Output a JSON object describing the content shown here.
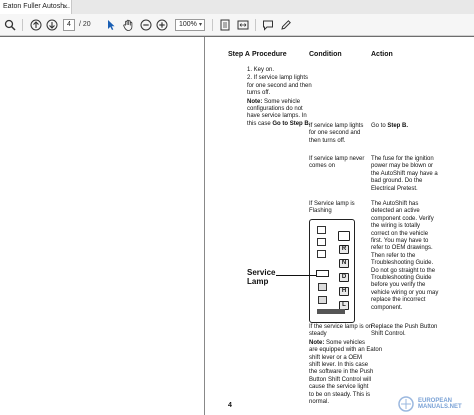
{
  "tab": {
    "title": "Eaton Fuller Autosh...",
    "close": "×"
  },
  "toolbar": {
    "page_current": "4",
    "page_total": "/ 20",
    "zoom": "100%",
    "zoom_arrow": "▾",
    "icons": [
      "search-icon",
      "page-up-icon",
      "page-down-icon",
      "select-cursor-icon",
      "hand-icon",
      "zoom-out-icon",
      "zoom-in-icon",
      "fit-page-icon",
      "fit-width-icon",
      "comment-icon",
      "edit-icon"
    ]
  },
  "table": {
    "headers": {
      "step": "Step A",
      "procedure": "Procedure",
      "condition": "Condition",
      "action": "Action"
    },
    "procedure_lines": [
      "1.  Key on.",
      "2.  If service lamp lights",
      "for one second and then",
      "turns off."
    ],
    "note_label": "Note:",
    "note_lines": [
      " Some vehicle",
      "configurations do not",
      "have service lamps. In",
      "this case"
    ],
    "note_goto": "Go to Step B.",
    "rows": [
      {
        "condition": [
          "If service lamp lights",
          "for one second and",
          "then turns off."
        ],
        "action_prefix": "Go to ",
        "action_bold": "Step B."
      },
      {
        "condition": [
          "If service lamp never",
          "comes on"
        ],
        "action": [
          "The fuse for the ignition",
          "power may be blown or",
          "the AutoShift may have a",
          "bad ground. Do the",
          "Electrical Pretest."
        ]
      },
      {
        "condition": [
          "If Service lamp is",
          "Flashing"
        ],
        "action": [
          "The AutoShift has",
          "detected an active",
          "component code. Verify",
          "the wiring is totally",
          "correct on the vehicle",
          "first. You may have to",
          "refer to OEM drawings.",
          "Then refer to the",
          "Troubleshooting Guide.",
          "Do not go straight to the",
          "Troubleshooting Guide",
          "before you verify the",
          "vehicle wiring or you may",
          "replace the incorrect",
          "component."
        ]
      },
      {
        "condition": [
          "If the service lamp is on",
          "steady"
        ],
        "action": [
          "Replace the Push Button",
          "Shift Control."
        ],
        "note_label": "Note:",
        "note_lines": [
          " Some vehicles",
          "are equipped with an Eaton",
          "shift lever or a OEM",
          "shift lever. In this case",
          "the software in the Push",
          "Button Shift Control will",
          "cause the service light",
          "to be on steady. This is",
          "normal."
        ]
      }
    ]
  },
  "diagram": {
    "callout": [
      "Service",
      "Lamp"
    ],
    "buttons": [
      "R",
      "N",
      "D",
      "H",
      "L"
    ]
  },
  "page_number": "4",
  "watermark": {
    "line1": "EUROPEAN",
    "line2": "MANUALS.NET"
  }
}
